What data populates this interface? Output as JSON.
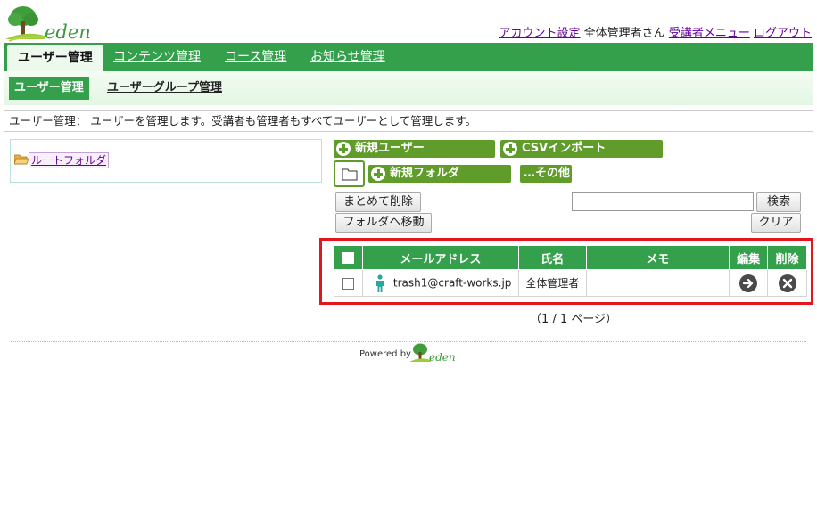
{
  "brand": {
    "logo_text": "eden"
  },
  "top_links": {
    "account_settings": "アカウント設定",
    "user_name": "全体管理者さん",
    "learner_menu": "受講者メニュー",
    "logout": "ログアウト"
  },
  "main_nav": {
    "tabs": [
      {
        "label": "ユーザー管理",
        "active": true
      },
      {
        "label": "コンテンツ管理",
        "active": false
      },
      {
        "label": "コース管理",
        "active": false
      },
      {
        "label": "お知らせ管理",
        "active": false
      }
    ]
  },
  "sub_nav": {
    "tabs": [
      {
        "label": "ユーザー管理",
        "active": true
      },
      {
        "label": "ユーザーグループ管理",
        "active": false
      }
    ]
  },
  "description": "ユーザー管理： ユーザーを管理します。受講者も管理者もすべてユーザーとして管理します。",
  "folder_tree": {
    "root_label": "ルートフォルダ"
  },
  "actions": {
    "new_user": "新規ユーザー",
    "csv_import": "CSVインポート",
    "new_folder": "新規フォルダ",
    "other": "…その他",
    "bulk_delete": "まとめて削除",
    "move_to_folder": "フォルダへ移動",
    "search": "検索",
    "clear": "クリア",
    "search_value": ""
  },
  "table": {
    "headers": {
      "email": "メールアドレス",
      "name": "氏名",
      "memo": "メモ",
      "edit": "編集",
      "delete": "削除"
    },
    "rows": [
      {
        "email": "trash1@craft-works.jp",
        "name": "全体管理者",
        "memo": ""
      }
    ]
  },
  "pager": "（1 / 1 ページ）",
  "footer": {
    "powered_by": "Powered by",
    "logo_text": "eden"
  },
  "colors": {
    "primary_green": "#34a04c",
    "action_green": "#5f9c2a",
    "highlight_red": "#e3151e",
    "link_purple": "#660099"
  }
}
